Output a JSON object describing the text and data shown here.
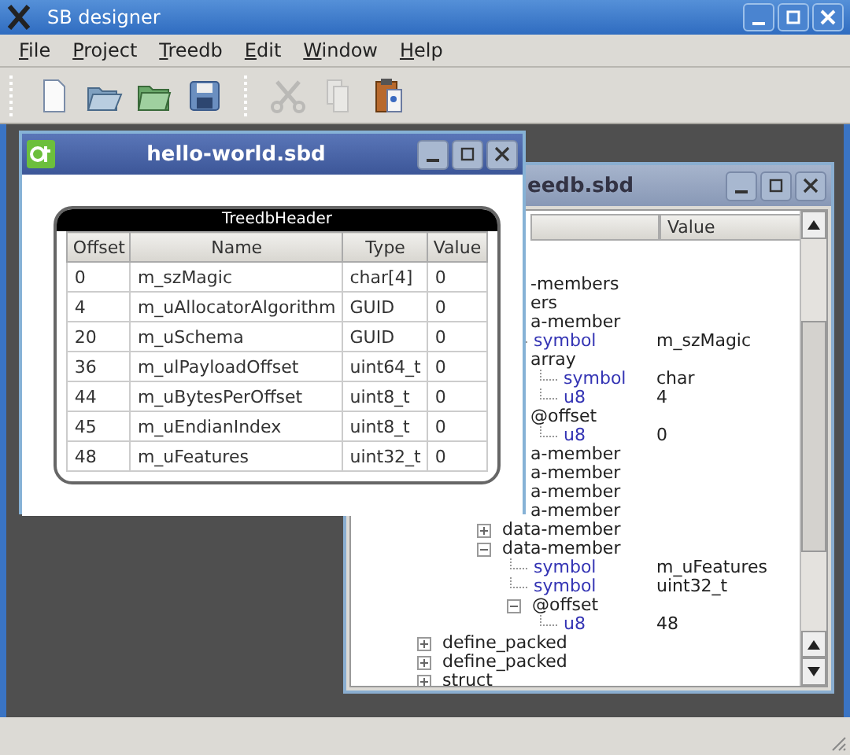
{
  "window": {
    "title": "SB designer"
  },
  "menu": [
    {
      "label": "File"
    },
    {
      "label": "Project"
    },
    {
      "label": "Treedb"
    },
    {
      "label": "Edit"
    },
    {
      "label": "Window"
    },
    {
      "label": "Help"
    }
  ],
  "toolbar": [
    {
      "items": [
        {
          "kind": "new",
          "disabled": false
        },
        {
          "kind": "open",
          "disabled": false
        },
        {
          "kind": "folder",
          "disabled": false
        },
        {
          "kind": "save",
          "disabled": false
        }
      ]
    },
    {
      "items": [
        {
          "kind": "cut",
          "disabled": true
        },
        {
          "kind": "copy",
          "disabled": true
        },
        {
          "kind": "paste",
          "disabled": false
        }
      ]
    }
  ],
  "front_window": {
    "title": "hello-world.sbd",
    "struct": {
      "title": "TreedbHeader",
      "columns": [
        "Offset",
        "Name",
        "Type",
        "Value"
      ],
      "rows": [
        [
          "0",
          "m_szMagic",
          "char[4]",
          "0"
        ],
        [
          "4",
          "m_uAllocatorAlgorithm",
          "GUID",
          "0"
        ],
        [
          "20",
          "m_uSchema",
          "GUID",
          "0"
        ],
        [
          "36",
          "m_ulPayloadOffset",
          "uint64_t",
          "0"
        ],
        [
          "44",
          "m_uBytesPerOffset",
          "uint8_t",
          "0"
        ],
        [
          "45",
          "m_uEndianIndex",
          "uint8_t",
          "0"
        ],
        [
          "48",
          "m_uFeatures",
          "uint32_t",
          "0"
        ]
      ]
    }
  },
  "back_window": {
    "title": "eedb.sbd",
    "columns": [
      "Value"
    ],
    "tree": [
      {
        "label": "-members",
        "kind": "element",
        "cut": true,
        "children": [
          {
            "label": "ers",
            "kind": "element",
            "cut": true,
            "children": [
              {
                "label": "a-member",
                "kind": "element",
                "cut": true,
                "children": [
                  {
                    "label": "symbol",
                    "kind": "attr",
                    "value": "m_szMagic"
                  },
                  {
                    "label": "array",
                    "kind": "element",
                    "cut": true,
                    "children": [
                      {
                        "label": "symbol",
                        "kind": "attr",
                        "value": "char"
                      },
                      {
                        "label": "u8",
                        "kind": "attr",
                        "value": "4"
                      }
                    ]
                  },
                  {
                    "label": "@offset",
                    "kind": "element",
                    "cut": true,
                    "children": [
                      {
                        "label": "u8",
                        "kind": "attr",
                        "value": "0"
                      }
                    ]
                  }
                ]
              },
              {
                "label": "a-member",
                "kind": "element",
                "cut": true
              },
              {
                "label": "a-member",
                "kind": "element",
                "cut": true
              },
              {
                "label": "a-member",
                "kind": "element",
                "cut": true
              },
              {
                "label": "a-member",
                "kind": "element",
                "cut": true
              },
              {
                "label": "data-member",
                "kind": "element",
                "expanded": false
              },
              {
                "label": "data-member",
                "kind": "element",
                "expanded": true,
                "children": [
                  {
                    "label": "symbol",
                    "kind": "attr",
                    "value": "m_uFeatures"
                  },
                  {
                    "label": "symbol",
                    "kind": "attr",
                    "value": "uint32_t"
                  },
                  {
                    "label": "@offset",
                    "kind": "element",
                    "expanded": true,
                    "children": [
                      {
                        "label": "u8",
                        "kind": "attr",
                        "value": "48"
                      }
                    ]
                  }
                ]
              }
            ]
          }
        ]
      },
      {
        "label": "define_packed",
        "kind": "element",
        "expanded": false
      },
      {
        "label": "define_packed",
        "kind": "element",
        "expanded": false
      },
      {
        "label": "struct",
        "kind": "element",
        "expanded": false
      }
    ]
  }
}
